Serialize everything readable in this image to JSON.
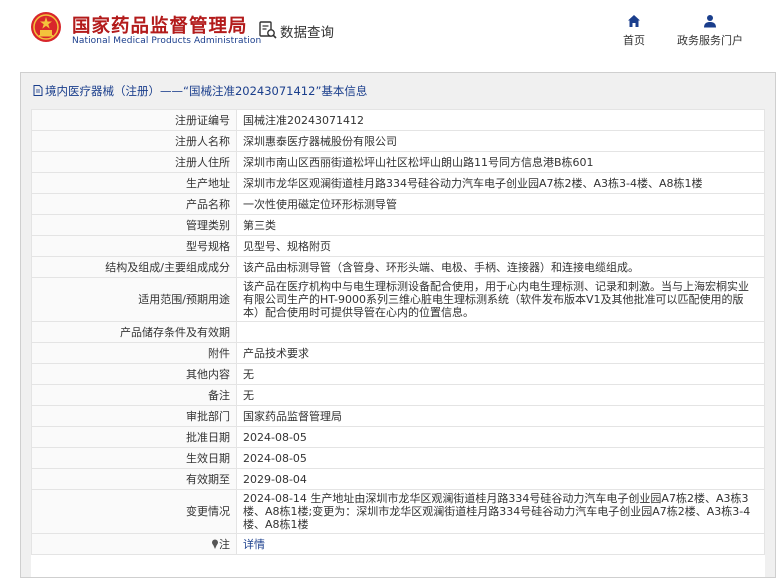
{
  "header": {
    "org_name_cn": "国家药品监督管理局",
    "org_name_en": "National Medical Products Administration",
    "query_label": "数据查询",
    "nav": [
      {
        "label": "首页",
        "icon": "home-icon"
      },
      {
        "label": "政务服务门户",
        "icon": "user-icon"
      }
    ]
  },
  "panel": {
    "title": "境内医疗器械（注册）——“国械注准20243071412”基本信息"
  },
  "rows": [
    {
      "key": "注册证编号",
      "value": "国械注准20243071412"
    },
    {
      "key": "注册人名称",
      "value": "深圳惠泰医疗器械股份有限公司"
    },
    {
      "key": "注册人住所",
      "value": "深圳市南山区西丽街道松坪山社区松坪山朗山路11号同方信息港B栋601"
    },
    {
      "key": "生产地址",
      "value": "深圳市龙华区观澜街道桂月路334号硅谷动力汽车电子创业园A7栋2楼、A3栋3-4楼、A8栋1楼"
    },
    {
      "key": "产品名称",
      "value": "一次性使用磁定位环形标测导管"
    },
    {
      "key": "管理类别",
      "value": "第三类"
    },
    {
      "key": "型号规格",
      "value": "见型号、规格附页"
    },
    {
      "key": "结构及组成/主要组成成分",
      "value": "该产品由标测导管（含管身、环形头端、电极、手柄、连接器）和连接电缆组成。"
    },
    {
      "key": "适用范围/预期用途",
      "value": "该产品在医疗机构中与电生理标测设备配合使用，用于心内电生理标测、记录和刺激。当与上海宏桐实业有限公司生产的HT-9000系列三维心脏电生理标测系统（软件发布版本V1及其他批准可以匹配使用的版本）配合使用时可提供导管在心内的位置信息。"
    },
    {
      "key": "产品储存条件及有效期",
      "value": ""
    },
    {
      "key": "附件",
      "value": "产品技术要求"
    },
    {
      "key": "其他内容",
      "value": "无"
    },
    {
      "key": "备注",
      "value": "无"
    },
    {
      "key": "审批部门",
      "value": "国家药品监督管理局"
    },
    {
      "key": "批准日期",
      "value": "2024-08-05"
    },
    {
      "key": "生效日期",
      "value": "2024-08-05"
    },
    {
      "key": "有效期至",
      "value": "2029-08-04"
    },
    {
      "key": "变更情况",
      "value": "2024-08-14 生产地址由深圳市龙华区观澜街道桂月路334号硅谷动力汽车电子创业园A7栋2楼、A3栋3楼、A8栋1楼;变更为：深圳市龙华区观澜街道桂月路334号硅谷动力汽车电子创业园A7栋2楼、A3栋3-4楼、A8栋1楼"
    },
    {
      "key": "注",
      "value": "详情"
    }
  ]
}
